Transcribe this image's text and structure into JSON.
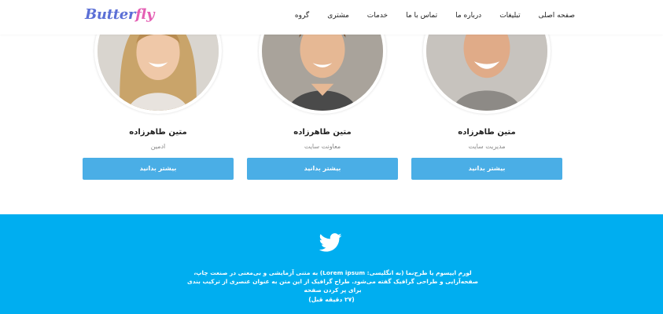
{
  "brand": {
    "logo_part1": "Butter",
    "logo_part2": "fly"
  },
  "nav": {
    "items": [
      "گروه",
      "مشتری",
      "خدمات",
      "تماس با ما",
      "درباره ما",
      "تبلیغات",
      "صفحه اصلی"
    ]
  },
  "team": {
    "members": [
      {
        "name": "متین طاهرزاده",
        "role": "ادمین",
        "button": "بیشتر بدانید"
      },
      {
        "name": "متین طاهرزاده",
        "role": "معاونت سایت",
        "button": "بیشتر بدانید"
      },
      {
        "name": "متین طاهرزاده",
        "role": "مدیریت سایت",
        "button": "بیشتر بدانید"
      }
    ]
  },
  "twitter": {
    "icon": "twitter-bird-icon",
    "tweet_text": "لورم ایپسوم یا طرح‌نما (به انگلیسی: Lorem ipsum) به متنی آزمایشی و بی‌معنی در صنعت چاپ، صفحه‌آرایی و طراحی گرافیک گفته می‌شود. طراح گرافیک از این متن به عنوان عنصری از ترکیب بندی برای پر کردن صفحه",
    "time": "(۲۷ دقیقه قبل)"
  },
  "colors": {
    "accent": "#4aaee6",
    "twitter_bg": "#00aef0",
    "logo_blue": "#5b6fd6",
    "logo_pink": "#e45fb4"
  }
}
